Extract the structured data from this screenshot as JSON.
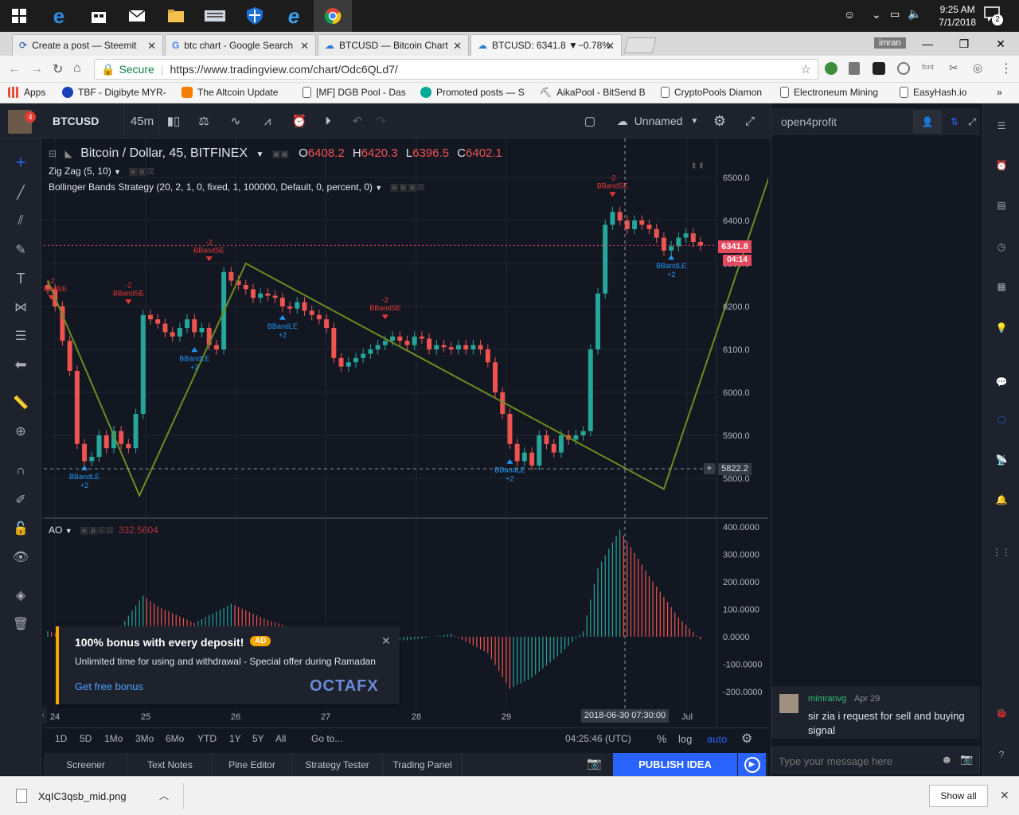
{
  "taskbar": {
    "time": "9:25 AM",
    "date": "7/1/2018",
    "notif_count": "2"
  },
  "tabs": [
    {
      "title": "Create a post — Steemit"
    },
    {
      "title": "btc chart - Google Search"
    },
    {
      "title": "BTCUSD — Bitcoin Chart"
    },
    {
      "title": "BTCUSD: 6341.8 ▼−0.78%"
    }
  ],
  "profile_name": "imran",
  "address": {
    "secure": "Secure",
    "url": "https://www.tradingview.com/chart/Odc6QLd7/"
  },
  "bookmarks": [
    {
      "label": "Apps"
    },
    {
      "label": "TBF - Digibyte MYR-"
    },
    {
      "label": "The Altcoin Update"
    },
    {
      "label": "[MF] DGB Pool - Das"
    },
    {
      "label": "Promoted posts — S"
    },
    {
      "label": "AikaPool - BitSend B"
    },
    {
      "label": "CryptoPools Diamon"
    },
    {
      "label": "Electroneum Mining"
    },
    {
      "label": "EasyHash.io"
    }
  ],
  "toolbar": {
    "symbol": "BTCUSD",
    "interval": "45m",
    "layout_name": "Unnamed",
    "avatar_badge": "4"
  },
  "legend": {
    "title": "Bitcoin / Dollar, 45, BITFINEX",
    "o_label": "O",
    "o": "6408.2",
    "h_label": "H",
    "h": "6420.3",
    "l_label": "L",
    "l": "6396.5",
    "c_label": "C",
    "c": "6402.1",
    "ind1": "Zig Zag (5, 10)",
    "ind2": "Bollinger Bands Strategy (20, 2, 1, 0, fixed, 1, 100000, Default, 0, percent, 0)",
    "ao_label": "AO",
    "ao_value": "332.5604"
  },
  "price_scale": [
    "6500.0",
    "6400.0",
    "6300.0",
    "6200.0",
    "6100.0",
    "6000.0",
    "5900.0",
    "5800.0"
  ],
  "last_price": "6341.8",
  "countdown": "04:14",
  "crosshair_price": "5822.2",
  "crosshair_time": "2018-06-30 07:30:00",
  "ao_scale": [
    "400.0000",
    "300.0000",
    "200.0000",
    "100.0000",
    "0.0000",
    "-100.0000",
    "-200.0000"
  ],
  "time_axis": [
    "24",
    "25",
    "26",
    "27",
    "28",
    "29",
    "Jul"
  ],
  "signals": [
    {
      "label": "BBandSE",
      "qty": "-2",
      "kind": "short"
    },
    {
      "label": "BBandSE",
      "qty": "-2",
      "kind": "short"
    },
    {
      "label": "BBandSE",
      "qty": "-2",
      "kind": "short"
    },
    {
      "label": "BBandSE",
      "qty": "-2",
      "kind": "short"
    },
    {
      "label": "BBandSE",
      "qty": "-2",
      "kind": "short"
    },
    {
      "label": "BBandLE",
      "qty": "+2",
      "kind": "long"
    },
    {
      "label": "BBandLE",
      "qty": "+2",
      "kind": "long"
    },
    {
      "label": "BBandLE",
      "qty": "+2",
      "kind": "long"
    },
    {
      "label": "BBandLE",
      "qty": "+2",
      "kind": "long"
    },
    {
      "label": "BBandLE",
      "qty": "+2",
      "kind": "long"
    }
  ],
  "timeframes": [
    "1D",
    "5D",
    "1Mo",
    "3Mo",
    "6Mo",
    "YTD",
    "1Y",
    "5Y",
    "All",
    "Go to..."
  ],
  "bottom_right": {
    "clock": "04:25:46 (UTC)",
    "pct": "%",
    "log": "log",
    "auto": "auto"
  },
  "bottom_tabs": [
    "Screener",
    "Text Notes",
    "Pine Editor",
    "Strategy Tester",
    "Trading Panel"
  ],
  "publish": "PUBLISH IDEA",
  "ad": {
    "title": "100% bonus with every deposit!",
    "badge": "AD",
    "subtitle": "Unlimited time for using and withdrawal - Special offer during Ramadan",
    "cta": "Get free bonus",
    "brand": "OCTAFX"
  },
  "chat": {
    "room": "open4profit",
    "message": {
      "user": "mimranvg",
      "date": "Apr 29",
      "text": "sir zia i request for sell and buying signal"
    },
    "input_placeholder": "Type your message here"
  },
  "download": {
    "file": "XqIC3qsb_mid.png",
    "show_all": "Show all"
  },
  "chart_data": {
    "type": "candlestick",
    "symbol": "BTCUSD",
    "interval": "45",
    "exchange": "BITFINEX",
    "ylim": [
      5750,
      6560
    ],
    "x_ticks": [
      "24",
      "25",
      "26",
      "27",
      "28",
      "29",
      "Jul"
    ],
    "zigzag": [
      [
        0,
        6260
      ],
      [
        12.5,
        5760
      ],
      [
        27,
        6300
      ],
      [
        84,
        5775
      ],
      [
        99,
        6535
      ]
    ],
    "price_path": [
      [
        0,
        6240
      ],
      [
        1,
        6200
      ],
      [
        2,
        6120
      ],
      [
        3,
        6050
      ],
      [
        4,
        5880
      ],
      [
        5,
        5840
      ],
      [
        6,
        5850
      ],
      [
        7,
        5900
      ],
      [
        8,
        5870
      ],
      [
        9,
        5910
      ],
      [
        10,
        5880
      ],
      [
        11,
        5870
      ],
      [
        12,
        5950
      ],
      [
        13,
        6180
      ],
      [
        14,
        6170
      ],
      [
        15,
        6160
      ],
      [
        16,
        6140
      ],
      [
        17,
        6130
      ],
      [
        18,
        6150
      ],
      [
        19,
        6170
      ],
      [
        20,
        6140
      ],
      [
        21,
        6150
      ],
      [
        22,
        6110
      ],
      [
        23,
        6100
      ],
      [
        24,
        6280
      ],
      [
        25,
        6260
      ],
      [
        26,
        6250
      ],
      [
        27,
        6240
      ],
      [
        28,
        6220
      ],
      [
        29,
        6230
      ],
      [
        30,
        6225
      ],
      [
        31,
        6220
      ],
      [
        32,
        6200
      ],
      [
        33,
        6195
      ],
      [
        34,
        6210
      ],
      [
        35,
        6190
      ],
      [
        36,
        6180
      ],
      [
        37,
        6170
      ],
      [
        38,
        6150
      ],
      [
        39,
        6080
      ],
      [
        40,
        6060
      ],
      [
        41,
        6070
      ],
      [
        42,
        6080
      ],
      [
        43,
        6090
      ],
      [
        44,
        6100
      ],
      [
        45,
        6110
      ],
      [
        46,
        6120
      ],
      [
        47,
        6130
      ],
      [
        48,
        6120
      ],
      [
        49,
        6110
      ],
      [
        50,
        6130
      ],
      [
        51,
        6125
      ],
      [
        52,
        6100
      ],
      [
        53,
        6110
      ],
      [
        54,
        6105
      ],
      [
        55,
        6100
      ],
      [
        56,
        6110
      ],
      [
        57,
        6100
      ],
      [
        58,
        6110
      ],
      [
        59,
        6100
      ],
      [
        60,
        6070
      ],
      [
        61,
        6000
      ],
      [
        62,
        5950
      ],
      [
        63,
        5880
      ],
      [
        64,
        5840
      ],
      [
        65,
        5860
      ],
      [
        66,
        5830
      ],
      [
        67,
        5900
      ],
      [
        68,
        5880
      ],
      [
        69,
        5860
      ],
      [
        70,
        5900
      ],
      [
        71,
        5890
      ],
      [
        72,
        5900
      ],
      [
        73,
        5910
      ],
      [
        74,
        6100
      ],
      [
        75,
        6230
      ],
      [
        76,
        6390
      ],
      [
        77,
        6420
      ],
      [
        78,
        6400
      ],
      [
        79,
        6380
      ],
      [
        80,
        6400
      ],
      [
        81,
        6390
      ],
      [
        82,
        6380
      ],
      [
        83,
        6360
      ],
      [
        84,
        6330
      ],
      [
        85,
        6340
      ],
      [
        86,
        6360
      ],
      [
        87,
        6370
      ],
      [
        88,
        6350
      ],
      [
        89,
        6341.8
      ]
    ],
    "ao_path": [
      [
        0,
        20
      ],
      [
        5,
        -10
      ],
      [
        10,
        40
      ],
      [
        13,
        150
      ],
      [
        15,
        110
      ],
      [
        20,
        50
      ],
      [
        25,
        120
      ],
      [
        30,
        60
      ],
      [
        35,
        20
      ],
      [
        40,
        -40
      ],
      [
        45,
        -20
      ],
      [
        50,
        -10
      ],
      [
        55,
        10
      ],
      [
        60,
        -60
      ],
      [
        63,
        -190
      ],
      [
        66,
        -150
      ],
      [
        70,
        -60
      ],
      [
        73,
        20
      ],
      [
        75,
        250
      ],
      [
        78,
        390
      ],
      [
        82,
        220
      ],
      [
        86,
        70
      ],
      [
        89,
        -10
      ]
    ]
  }
}
